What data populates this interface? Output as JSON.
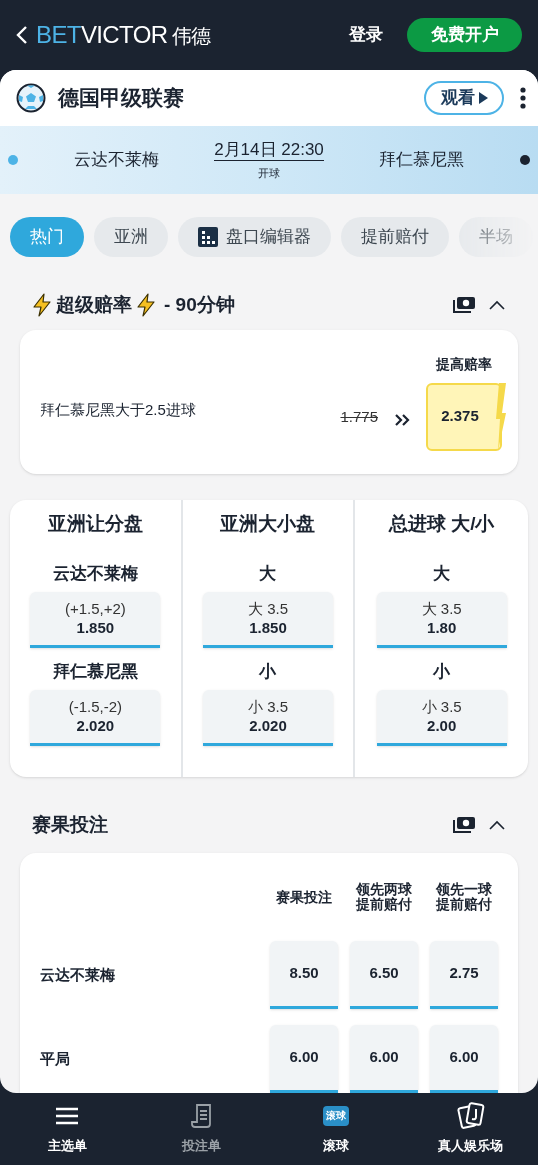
{
  "header": {
    "logo": {
      "part_1": "BET",
      "part_2": "VICTOR",
      "part_3": "伟德"
    },
    "login": "登录",
    "signup": "免费开户"
  },
  "event": {
    "league": "德国甲级联赛",
    "watch": "观看",
    "time": "2月14日 22:30",
    "status": "开球",
    "teams": [
      {
        "name": "云达不莱梅",
        "color": "#4db3e6"
      },
      {
        "name": "拜仁慕尼黑",
        "color": "#1b2330"
      }
    ]
  },
  "tabs": [
    {
      "label": "热门",
      "selected": true,
      "kind": "text"
    },
    {
      "label": "亚洲",
      "selected": false,
      "kind": "text"
    },
    {
      "label": "盘口编辑器",
      "selected": false,
      "kind": "icon"
    },
    {
      "label": "提前赔付",
      "selected": false,
      "kind": "text"
    },
    {
      "label": "半场",
      "selected": false,
      "kind": "text"
    }
  ],
  "super_odds": {
    "title": "超级赔率",
    "suffix": "- 90分钟",
    "column": "提高赔率",
    "selection": "拜仁慕尼黑大于2.5进球",
    "old_odds": "1.775",
    "new_odds": "2.375"
  },
  "asian_markets": [
    {
      "title": "亚洲让分盘",
      "rows": [
        {
          "label": "云达不莱梅",
          "line": "(+1.5,+2)",
          "odds": "1.850"
        },
        {
          "label": "拜仁慕尼黑",
          "line": "(-1.5,-2)",
          "odds": "2.020"
        }
      ]
    },
    {
      "title": "亚洲大小盘",
      "rows": [
        {
          "label": "大",
          "line": "大 3.5",
          "odds": "1.850"
        },
        {
          "label": "小",
          "line": "小 3.5",
          "odds": "2.020"
        }
      ]
    },
    {
      "title": "总进球 大/小",
      "rows": [
        {
          "label": "大",
          "line": "大 3.5",
          "odds": "1.80"
        },
        {
          "label": "小",
          "line": "小 3.5",
          "odds": "2.00"
        }
      ]
    }
  ],
  "match_result": {
    "title": "赛果投注",
    "columns": [
      "赛果投注",
      "领先两球提前赔付",
      "领先一球提前赔付"
    ],
    "rows": [
      {
        "label": "云达不莱梅",
        "odds": [
          "8.50",
          "6.50",
          "2.75"
        ]
      },
      {
        "label": "平局",
        "odds": [
          "6.00",
          "6.00",
          "6.00"
        ]
      }
    ]
  },
  "bottom_nav": [
    {
      "label": "主选单",
      "kind": "menu",
      "disabled": false
    },
    {
      "label": "投注单",
      "kind": "betslip",
      "disabled": true
    },
    {
      "label": "滚球",
      "kind": "live",
      "badge": "滚球",
      "disabled": false
    },
    {
      "label": "真人娱乐场",
      "kind": "cards",
      "disabled": false
    }
  ]
}
